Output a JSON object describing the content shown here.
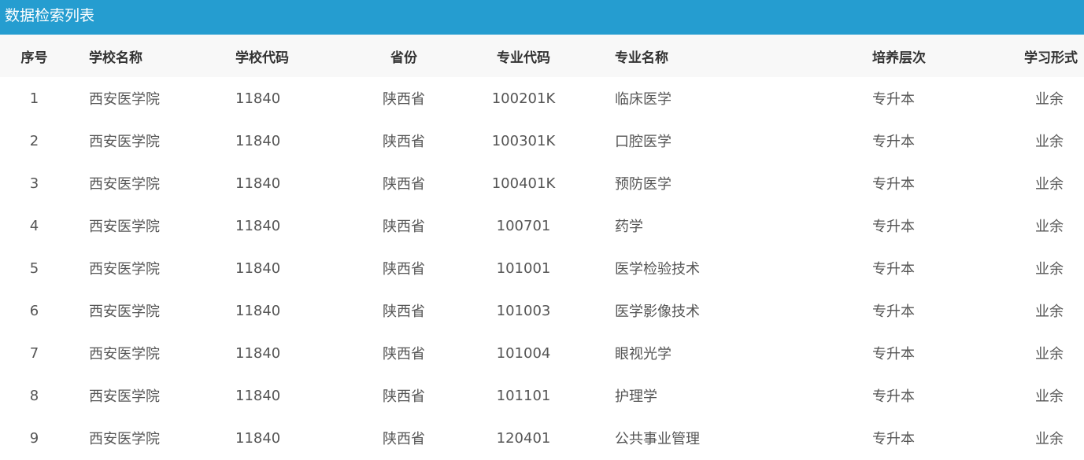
{
  "panel": {
    "title": "数据检索列表"
  },
  "table": {
    "headers": {
      "index": "序号",
      "school_name": "学校名称",
      "school_code": "学校代码",
      "province": "省份",
      "major_code": "专业代码",
      "major_name": "专业名称",
      "level": "培养层次",
      "study_form": "学习形式"
    },
    "rows": [
      {
        "index": "1",
        "school_name": "西安医学院",
        "school_code": "11840",
        "province": "陕西省",
        "major_code": "100201K",
        "major_name": "临床医学",
        "level": "专升本",
        "study_form": "业余"
      },
      {
        "index": "2",
        "school_name": "西安医学院",
        "school_code": "11840",
        "province": "陕西省",
        "major_code": "100301K",
        "major_name": "口腔医学",
        "level": "专升本",
        "study_form": "业余"
      },
      {
        "index": "3",
        "school_name": "西安医学院",
        "school_code": "11840",
        "province": "陕西省",
        "major_code": "100401K",
        "major_name": "预防医学",
        "level": "专升本",
        "study_form": "业余"
      },
      {
        "index": "4",
        "school_name": "西安医学院",
        "school_code": "11840",
        "province": "陕西省",
        "major_code": "100701",
        "major_name": "药学",
        "level": "专升本",
        "study_form": "业余"
      },
      {
        "index": "5",
        "school_name": "西安医学院",
        "school_code": "11840",
        "province": "陕西省",
        "major_code": "101001",
        "major_name": "医学检验技术",
        "level": "专升本",
        "study_form": "业余"
      },
      {
        "index": "6",
        "school_name": "西安医学院",
        "school_code": "11840",
        "province": "陕西省",
        "major_code": "101003",
        "major_name": "医学影像技术",
        "level": "专升本",
        "study_form": "业余"
      },
      {
        "index": "7",
        "school_name": "西安医学院",
        "school_code": "11840",
        "province": "陕西省",
        "major_code": "101004",
        "major_name": "眼视光学",
        "level": "专升本",
        "study_form": "业余"
      },
      {
        "index": "8",
        "school_name": "西安医学院",
        "school_code": "11840",
        "province": "陕西省",
        "major_code": "101101",
        "major_name": "护理学",
        "level": "专升本",
        "study_form": "业余"
      },
      {
        "index": "9",
        "school_name": "西安医学院",
        "school_code": "11840",
        "province": "陕西省",
        "major_code": "120401",
        "major_name": "公共事业管理",
        "level": "专升本",
        "study_form": "业余"
      }
    ]
  },
  "colors": {
    "header_bar": "#259dd0",
    "table_head_bg": "#f8f8f8"
  }
}
